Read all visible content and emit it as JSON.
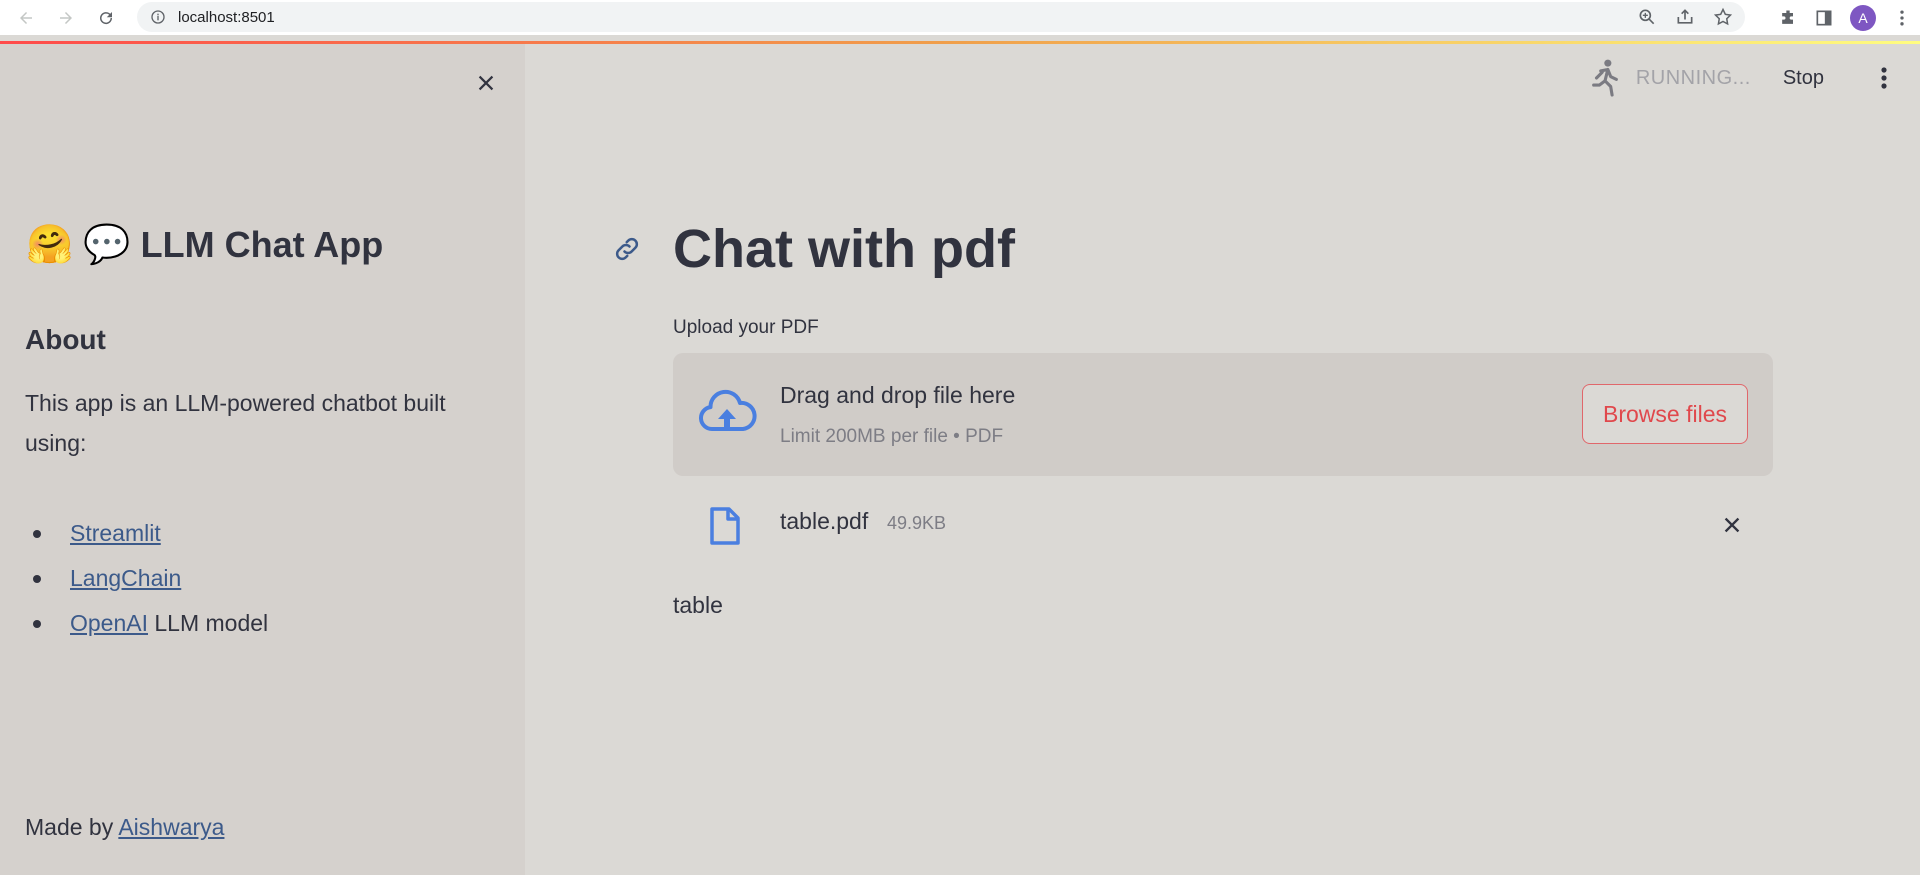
{
  "browser": {
    "url": "localhost:8501",
    "profile_initial": "A"
  },
  "sidebar": {
    "app_title": "LLM Chat App",
    "title_emojis": [
      "🤗",
      "💬"
    ],
    "about_heading": "About",
    "description": "This app is an LLM-powered chatbot built using:",
    "links": [
      {
        "link": "Streamlit",
        "suffix": ""
      },
      {
        "link": "LangChain",
        "suffix": ""
      },
      {
        "link": "OpenAI",
        "suffix": " LLM model"
      }
    ],
    "made_by_prefix": "Made by ",
    "made_by_link": "Aishwarya"
  },
  "header": {
    "status": "RUNNING...",
    "stop_label": "Stop"
  },
  "main": {
    "title": "Chat with pdf",
    "upload_label": "Upload your PDF",
    "dropzone_text": "Drag and drop file here",
    "dropzone_limit": "Limit 200MB per file • PDF",
    "browse_label": "Browse files",
    "file_name": "table.pdf",
    "file_size": "49.9KB",
    "output": "table"
  },
  "colors": {
    "accent": "#ff4b4b",
    "link": "#3c5a8a",
    "icon_blue": "#4a7fe0"
  }
}
